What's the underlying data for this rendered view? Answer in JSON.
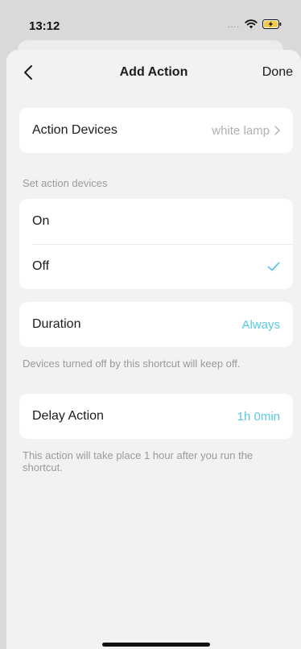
{
  "status_bar": {
    "time": "13:12",
    "signal": "....",
    "icons": [
      "wifi-icon",
      "battery-charging-icon"
    ]
  },
  "nav": {
    "title": "Add Action",
    "done_label": "Done",
    "back_icon": "chevron-left-icon"
  },
  "action_devices": {
    "label": "Action Devices",
    "value": "white lamp",
    "icon": "chevron-right-icon"
  },
  "set_action": {
    "section_label": "Set action devices",
    "options": [
      {
        "label": "On",
        "selected": false
      },
      {
        "label": "Off",
        "selected": true
      }
    ],
    "selected_icon": "checkmark-icon"
  },
  "duration": {
    "label": "Duration",
    "value": "Always",
    "note": "Devices turned off by this shortcut will keep off."
  },
  "delay": {
    "label": "Delay Action",
    "value": "1h 0min",
    "note": "This action will take place 1 hour after you run the shortcut."
  },
  "colors": {
    "accent": "#5bc8e6",
    "background": "#f2f2f3",
    "card": "#ffffff",
    "muted": "#9a9a9a"
  }
}
